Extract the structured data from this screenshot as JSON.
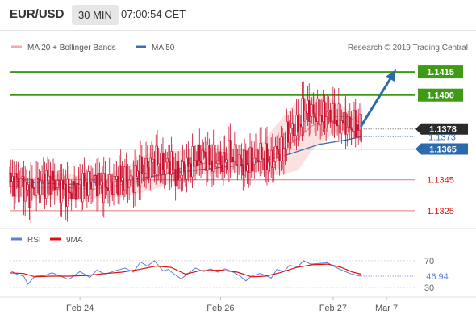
{
  "header": {
    "pair": "EUR/USD",
    "timeframe": "30 MIN",
    "time": "07:00:54 CET"
  },
  "legend": {
    "ma20_bb": "MA 20 + Bollinger Bands",
    "ma50": "MA 50",
    "copyright": "Research © 2019 Trading Central",
    "rsi": "RSI",
    "ma9": "9MA"
  },
  "colors": {
    "candle": "#c8102e",
    "bollinger": "#f7a9a9",
    "ma50": "#3a6fb0",
    "target": "#3f9a16",
    "support": "#e07a7a",
    "arrow": "#2b6aad",
    "current": "#2a2a2a",
    "rsi": "#5b7fd9",
    "ma9": "#e01010"
  },
  "chart_data": [
    {
      "type": "candlestick",
      "x_tick_labels": [
        "Feb 24",
        "Feb 26",
        "Feb 27",
        "Mar 7"
      ],
      "ylim": [
        1.1315,
        1.1425
      ],
      "levels": [
        {
          "label": "1.1415",
          "value": 1.1415,
          "kind": "target"
        },
        {
          "label": "1.1400",
          "value": 1.14,
          "kind": "target"
        },
        {
          "label": "1.1378",
          "value": 1.1378,
          "kind": "current"
        },
        {
          "label": "1.1373",
          "value": 1.1373,
          "kind": "ma50-value"
        },
        {
          "label": "1.1365",
          "value": 1.1365,
          "kind": "pivot"
        },
        {
          "label": "1.1345",
          "value": 1.1345,
          "kind": "support"
        },
        {
          "label": "1.1325",
          "value": 1.1325,
          "kind": "support"
        }
      ],
      "close_path": [
        [
          0,
          1.1344
        ],
        [
          8,
          1.1343
        ],
        [
          13,
          1.1337
        ],
        [
          20,
          1.1342
        ],
        [
          28,
          1.1345
        ],
        [
          36,
          1.134
        ],
        [
          42,
          1.1337
        ],
        [
          50,
          1.1341
        ],
        [
          57,
          1.1343
        ],
        [
          61,
          1.1345
        ],
        [
          66,
          1.134
        ],
        [
          73,
          1.1343
        ],
        [
          79,
          1.1346
        ],
        [
          86,
          1.1344
        ],
        [
          92,
          1.135
        ],
        [
          100,
          1.1354
        ],
        [
          103,
          1.1358
        ],
        [
          109,
          1.1353
        ],
        [
          114,
          1.1357
        ],
        [
          119,
          1.1347
        ],
        [
          126,
          1.1353
        ],
        [
          132,
          1.1358
        ],
        [
          137,
          1.1361
        ],
        [
          143,
          1.1357
        ],
        [
          148,
          1.1358
        ],
        [
          152,
          1.1356
        ],
        [
          157,
          1.1361
        ],
        [
          161,
          1.1359
        ],
        [
          167,
          1.1354
        ],
        [
          172,
          1.1356
        ],
        [
          177,
          1.1362
        ],
        [
          181,
          1.1358
        ],
        [
          186,
          1.1356
        ],
        [
          190,
          1.1364
        ],
        [
          194,
          1.1362
        ],
        [
          198,
          1.1376
        ],
        [
          205,
          1.1379
        ],
        [
          209,
          1.139
        ],
        [
          216,
          1.1388
        ],
        [
          222,
          1.1386
        ],
        [
          228,
          1.1387
        ],
        [
          233,
          1.1384
        ],
        [
          238,
          1.1382
        ],
        [
          241,
          1.138
        ],
        [
          247,
          1.138
        ],
        [
          250,
          1.1378
        ]
      ],
      "ma20_path": [
        [
          0,
          1.1341
        ],
        [
          20,
          1.134
        ],
        [
          40,
          1.134
        ],
        [
          60,
          1.1339
        ],
        [
          80,
          1.1342
        ],
        [
          100,
          1.1346
        ],
        [
          120,
          1.1352
        ],
        [
          140,
          1.1356
        ],
        [
          160,
          1.1357
        ],
        [
          175,
          1.1357
        ],
        [
          190,
          1.1362
        ],
        [
          205,
          1.1372
        ],
        [
          215,
          1.138
        ],
        [
          230,
          1.1386
        ],
        [
          240,
          1.1386
        ],
        [
          250,
          1.1382
        ]
      ],
      "bollinger_upper": [
        [
          0,
          1.1346
        ],
        [
          20,
          1.1347
        ],
        [
          40,
          1.1349
        ],
        [
          60,
          1.1346
        ],
        [
          80,
          1.1352
        ],
        [
          100,
          1.1363
        ],
        [
          120,
          1.1364
        ],
        [
          140,
          1.1366
        ],
        [
          160,
          1.1365
        ],
        [
          175,
          1.1364
        ],
        [
          190,
          1.1381
        ],
        [
          205,
          1.1397
        ],
        [
          215,
          1.1402
        ],
        [
          230,
          1.1397
        ],
        [
          240,
          1.1391
        ],
        [
          250,
          1.1385
        ]
      ],
      "bollinger_lower": [
        [
          0,
          1.1334
        ],
        [
          20,
          1.1333
        ],
        [
          40,
          1.1331
        ],
        [
          60,
          1.1333
        ],
        [
          80,
          1.1334
        ],
        [
          100,
          1.1338
        ],
        [
          120,
          1.1345
        ],
        [
          140,
          1.1349
        ],
        [
          160,
          1.135
        ],
        [
          175,
          1.135
        ],
        [
          190,
          1.1348
        ],
        [
          205,
          1.1351
        ],
        [
          215,
          1.1364
        ],
        [
          230,
          1.1375
        ],
        [
          240,
          1.1376
        ],
        [
          250,
          1.1377
        ]
      ],
      "ma50_path": [
        [
          0,
          1.1344
        ],
        [
          40,
          1.1342
        ],
        [
          80,
          1.1344
        ],
        [
          120,
          1.135
        ],
        [
          160,
          1.1354
        ],
        [
          180,
          1.1357
        ],
        [
          200,
          1.1362
        ],
        [
          220,
          1.1368
        ],
        [
          240,
          1.1371
        ],
        [
          250,
          1.1373
        ]
      ],
      "forecast_arrow": [
        [
          250,
          1.138
        ],
        [
          273,
          1.1414
        ]
      ]
    },
    {
      "type": "line",
      "tick_labels": [
        "70",
        "30"
      ],
      "ylim": [
        18,
        88
      ],
      "current_value": "46.94",
      "series": [
        {
          "name": "RSI",
          "points": [
            [
              0,
              56
            ],
            [
              5,
              50
            ],
            [
              10,
              47
            ],
            [
              13,
              35
            ],
            [
              18,
              47
            ],
            [
              25,
              48
            ],
            [
              30,
              52
            ],
            [
              35,
              48
            ],
            [
              42,
              42
            ],
            [
              50,
              54
            ],
            [
              57,
              45
            ],
            [
              62,
              56
            ],
            [
              68,
              50
            ],
            [
              75,
              55
            ],
            [
              82,
              59
            ],
            [
              88,
              53
            ],
            [
              93,
              68
            ],
            [
              98,
              62
            ],
            [
              103,
              70
            ],
            [
              109,
              55
            ],
            [
              113,
              57
            ],
            [
              117,
              50
            ],
            [
              122,
              43
            ],
            [
              127,
              51
            ],
            [
              132,
              59
            ],
            [
              138,
              54
            ],
            [
              143,
              58
            ],
            [
              148,
              53
            ],
            [
              153,
              58
            ],
            [
              159,
              53
            ],
            [
              164,
              47
            ],
            [
              168,
              40
            ],
            [
              172,
              47
            ],
            [
              178,
              51
            ],
            [
              182,
              48
            ],
            [
              186,
              44
            ],
            [
              190,
              57
            ],
            [
              195,
              54
            ],
            [
              199,
              63
            ],
            [
              205,
              61
            ],
            [
              209,
              70
            ],
            [
              214,
              65
            ],
            [
              220,
              66
            ],
            [
              226,
              67
            ],
            [
              232,
              60
            ],
            [
              236,
              56
            ],
            [
              242,
              51
            ],
            [
              247,
              48
            ],
            [
              250,
              47
            ]
          ]
        },
        {
          "name": "9MA",
          "points": [
            [
              0,
              52
            ],
            [
              10,
              51
            ],
            [
              18,
              46
            ],
            [
              30,
              47
            ],
            [
              42,
              47
            ],
            [
              55,
              48
            ],
            [
              68,
              51
            ],
            [
              80,
              53
            ],
            [
              92,
              57
            ],
            [
              104,
              62
            ],
            [
              115,
              60
            ],
            [
              125,
              50
            ],
            [
              135,
              55
            ],
            [
              150,
              56
            ],
            [
              162,
              53
            ],
            [
              172,
              46
            ],
            [
              182,
              47
            ],
            [
              192,
              52
            ],
            [
              204,
              60
            ],
            [
              215,
              64
            ],
            [
              226,
              65
            ],
            [
              236,
              60
            ],
            [
              244,
              53
            ],
            [
              250,
              50
            ]
          ]
        }
      ]
    }
  ]
}
